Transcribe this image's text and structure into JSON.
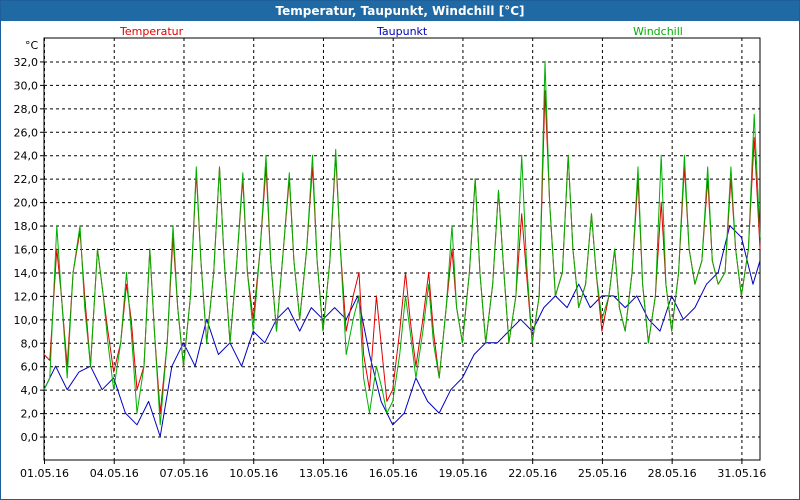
{
  "window": {
    "title": "Temperatur, Taupunkt, Windchill [°C]"
  },
  "colors": {
    "temperature": "#e00000",
    "dewpoint": "#0000c0",
    "windchill": "#00b000",
    "titlebar": "#1f6aa5"
  },
  "chart_data": {
    "type": "line",
    "title": "Temperatur, Taupunkt, Windchill [°C]",
    "ylabel": "°C",
    "xlabel": "",
    "ylim": [
      -2,
      34
    ],
    "xlim": [
      0,
      30.8
    ],
    "grid": true,
    "legend": "top",
    "y_ticks": [
      0,
      2,
      4,
      6,
      8,
      10,
      12,
      14,
      16,
      18,
      20,
      22,
      24,
      26,
      28,
      30,
      32
    ],
    "y_tick_labels": [
      "0,0",
      "2,0",
      "4,0",
      "6,0",
      "8,0",
      "10,0",
      "12,0",
      "14,0",
      "16,0",
      "18,0",
      "20,0",
      "22,0",
      "24,0",
      "26,0",
      "28,0",
      "30,0",
      "32,0"
    ],
    "x_ticks": [
      0,
      3,
      6,
      9,
      12,
      15,
      18,
      21,
      24,
      27,
      30
    ],
    "x_tick_labels": [
      "01.05.16",
      "04.05.16",
      "07.05.16",
      "10.05.16",
      "13.05.16",
      "16.05.16",
      "19.05.16",
      "22.05.16",
      "25.05.16",
      "28.05.16",
      "31.05.16"
    ],
    "series": [
      {
        "name": "Temperatur",
        "color": "#e00000",
        "x": [
          0,
          0.25,
          0.55,
          0.75,
          1.0,
          1.25,
          1.55,
          1.75,
          2.0,
          2.3,
          2.55,
          2.75,
          3.0,
          3.3,
          3.55,
          3.75,
          4.0,
          4.3,
          4.55,
          4.75,
          5.0,
          5.3,
          5.55,
          5.75,
          6.0,
          6.3,
          6.55,
          6.75,
          7.0,
          7.3,
          7.55,
          7.75,
          8.0,
          8.3,
          8.55,
          8.75,
          9.0,
          9.3,
          9.55,
          9.75,
          10.0,
          10.3,
          10.55,
          10.75,
          11.0,
          11.3,
          11.55,
          11.75,
          12.0,
          12.3,
          12.55,
          12.75,
          13.0,
          13.3,
          13.55,
          13.75,
          14.0,
          14.3,
          14.55,
          14.75,
          15.0,
          15.3,
          15.55,
          15.75,
          16.0,
          16.3,
          16.55,
          16.75,
          17.0,
          17.3,
          17.55,
          17.75,
          18.0,
          18.3,
          18.55,
          18.75,
          19.0,
          19.3,
          19.55,
          19.75,
          20.0,
          20.3,
          20.55,
          20.75,
          21.0,
          21.3,
          21.55,
          21.75,
          22.0,
          22.3,
          22.55,
          22.75,
          23.0,
          23.3,
          23.55,
          23.75,
          24.0,
          24.3,
          24.55,
          24.75,
          25.0,
          25.3,
          25.55,
          25.75,
          26.0,
          26.3,
          26.55,
          26.75,
          27.0,
          27.3,
          27.55,
          27.75,
          28.0,
          28.3,
          28.55,
          28.75,
          29.0,
          29.3,
          29.55,
          29.75,
          30.0,
          30.3,
          30.55,
          30.8
        ],
        "values": [
          7,
          6.5,
          16,
          12,
          6,
          14,
          17.5,
          12,
          6,
          16,
          12,
          9,
          5.5,
          8,
          13,
          10,
          4,
          6,
          16,
          9,
          2,
          8,
          17,
          11,
          6,
          12,
          22.5,
          15,
          8,
          14,
          23,
          15,
          8,
          15,
          22,
          14,
          10,
          16,
          23,
          15,
          9,
          16,
          22,
          15,
          10,
          16,
          23,
          15,
          9,
          15,
          24,
          16,
          9,
          12,
          14,
          7,
          4,
          12,
          7,
          3,
          4,
          9,
          14,
          10,
          6,
          10,
          14,
          9,
          5,
          11,
          16,
          11,
          8,
          14,
          22,
          14,
          8,
          13,
          21,
          15,
          8,
          12,
          19,
          14,
          8,
          12,
          29.5,
          20,
          12,
          14,
          24,
          16,
          11,
          13,
          19,
          14,
          9,
          12,
          16,
          11,
          9,
          14,
          22,
          13,
          8,
          12,
          20,
          13,
          9,
          14,
          23,
          16,
          13,
          15,
          22,
          15,
          13,
          14,
          22,
          16,
          12,
          16,
          25.5,
          16
        ]
      },
      {
        "name": "Taupunkt",
        "color": "#0000c0",
        "x": [
          0,
          0.5,
          1.0,
          1.5,
          2.0,
          2.5,
          3.0,
          3.5,
          4.0,
          4.5,
          5.0,
          5.5,
          6.0,
          6.5,
          7.0,
          7.5,
          8.0,
          8.5,
          9.0,
          9.5,
          10.0,
          10.5,
          11.0,
          11.5,
          12.0,
          12.5,
          13.0,
          13.5,
          14.0,
          14.5,
          15.0,
          15.5,
          16.0,
          16.5,
          17.0,
          17.5,
          18.0,
          18.5,
          19.0,
          19.5,
          20.0,
          20.5,
          21.0,
          21.5,
          22.0,
          22.5,
          23.0,
          23.5,
          24.0,
          24.5,
          25.0,
          25.5,
          26.0,
          26.5,
          27.0,
          27.5,
          28.0,
          28.5,
          29.0,
          29.5,
          30.0,
          30.5,
          30.8
        ],
        "values": [
          4,
          6,
          4,
          5.5,
          6,
          4,
          5,
          2,
          1,
          3,
          0,
          6,
          8,
          6,
          10,
          7,
          8,
          6,
          9,
          8,
          10,
          11,
          9,
          11,
          10,
          11,
          10,
          12,
          7,
          3,
          1,
          2,
          5,
          3,
          2,
          4,
          5,
          7,
          8,
          8,
          9,
          10,
          9,
          11,
          12,
          11,
          13,
          11,
          12,
          12,
          11,
          12,
          10,
          9,
          12,
          10,
          11,
          13,
          14,
          18,
          17,
          13,
          15
        ]
      },
      {
        "name": "Windchill",
        "color": "#00b000",
        "x": [
          0,
          0.25,
          0.55,
          0.75,
          1.0,
          1.25,
          1.55,
          1.75,
          2.0,
          2.3,
          2.55,
          2.75,
          3.0,
          3.3,
          3.55,
          3.75,
          4.0,
          4.3,
          4.55,
          4.75,
          5.0,
          5.3,
          5.55,
          5.75,
          6.0,
          6.3,
          6.55,
          6.75,
          7.0,
          7.3,
          7.55,
          7.75,
          8.0,
          8.3,
          8.55,
          8.75,
          9.0,
          9.3,
          9.55,
          9.75,
          10.0,
          10.3,
          10.55,
          10.75,
          11.0,
          11.3,
          11.55,
          11.75,
          12.0,
          12.3,
          12.55,
          12.75,
          13.0,
          13.3,
          13.55,
          13.75,
          14.0,
          14.3,
          14.55,
          14.75,
          15.0,
          15.3,
          15.55,
          15.75,
          16.0,
          16.3,
          16.55,
          16.75,
          17.0,
          17.3,
          17.55,
          17.75,
          18.0,
          18.3,
          18.55,
          18.75,
          19.0,
          19.3,
          19.55,
          19.75,
          20.0,
          20.3,
          20.55,
          20.75,
          21.0,
          21.3,
          21.55,
          21.75,
          22.0,
          22.3,
          22.55,
          22.75,
          23.0,
          23.3,
          23.55,
          23.75,
          24.0,
          24.3,
          24.55,
          24.75,
          25.0,
          25.3,
          25.55,
          25.75,
          26.0,
          26.3,
          26.55,
          26.75,
          27.0,
          27.3,
          27.55,
          27.75,
          28.0,
          28.3,
          28.55,
          28.75,
          29.0,
          29.3,
          29.55,
          29.75,
          30.0,
          30.3,
          30.55,
          30.8
        ],
        "values": [
          4,
          5,
          18,
          12,
          5,
          14,
          18,
          11,
          6,
          16,
          12,
          8,
          4,
          8,
          14,
          9,
          2,
          6,
          16,
          9,
          1,
          8,
          18,
          11,
          6,
          12,
          23,
          15,
          8,
          14,
          23,
          15,
          8,
          15,
          22.5,
          14,
          9,
          16,
          24,
          15,
          9,
          16,
          22.5,
          15,
          10,
          16,
          24,
          15,
          9,
          15,
          24.5,
          16,
          7,
          10,
          12,
          5,
          2,
          6,
          4,
          2,
          3,
          7,
          12,
          9,
          5,
          9,
          13,
          8,
          5,
          11,
          18,
          11,
          8,
          14,
          22,
          14,
          8,
          13,
          21,
          15,
          8,
          12,
          24,
          15,
          8,
          12,
          32,
          20,
          12,
          14,
          24,
          16,
          11,
          13,
          19,
          14,
          10,
          12,
          16,
          11,
          9,
          14,
          23,
          13,
          8,
          12,
          24,
          13,
          9,
          14,
          24,
          16,
          13,
          15,
          23,
          15,
          13,
          14,
          23,
          16,
          12,
          16,
          27.5,
          17
        ]
      }
    ]
  }
}
